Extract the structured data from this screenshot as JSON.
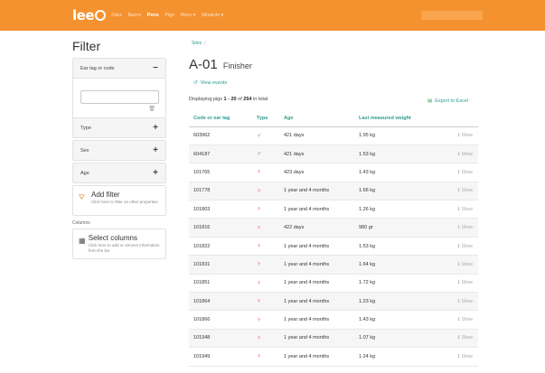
{
  "app": {
    "logo": "lee",
    "nav": [
      "Sites",
      "Barns",
      "Pens",
      "Pigs",
      "More ▾",
      "Wizards ▾"
    ],
    "nav_active_index": 2
  },
  "sidebar": {
    "title": "Filter",
    "ear_tag": {
      "label": "Ear tag or code",
      "value": "",
      "placeholder": ""
    },
    "filters": [
      {
        "label": "Type"
      },
      {
        "label": "Sex"
      },
      {
        "label": "Age"
      }
    ],
    "add_filter": {
      "title": "Add filter",
      "description": "Click here to filter on other properties"
    },
    "columns_label": "Columns",
    "select_columns": {
      "title": "Select columns",
      "description": "Click here to add or remove information from the list"
    }
  },
  "main": {
    "breadcrumb": "Sites",
    "title": "A-01",
    "subtitle": "Finisher",
    "view_events": "View events",
    "displaying": {
      "prefix": "Displaying pigs ",
      "range": "1 - 20",
      "mid": " of ",
      "total": "254",
      "suffix": " in total"
    },
    "export": "Export to Excel",
    "columns": [
      "Code or ear tag",
      "Type",
      "Age",
      "Last measured weight",
      ""
    ],
    "rows": [
      {
        "code": "603962",
        "sex": "♂",
        "sex_kind": "m",
        "age": "421 days",
        "weight": "1.95 kg",
        "action": "Show"
      },
      {
        "code": "604187",
        "sex": "♂",
        "sex_kind": "m",
        "age": "421 days",
        "weight": "1.53 kg",
        "action": "Show"
      },
      {
        "code": "101765",
        "sex": "♀",
        "sex_kind": "f",
        "age": "423 days",
        "weight": "1.43 kg",
        "action": "Show"
      },
      {
        "code": "101778",
        "sex": "♀",
        "sex_kind": "f",
        "age": "1 year and 4 months",
        "weight": "1.66 kg",
        "action": "Show"
      },
      {
        "code": "101803",
        "sex": "♀",
        "sex_kind": "f",
        "age": "1 year and 4 months",
        "weight": "1.26 kg",
        "action": "Show"
      },
      {
        "code": "101816",
        "sex": "♀",
        "sex_kind": "f",
        "age": "422 days",
        "weight": "980 gr",
        "action": "Show"
      },
      {
        "code": "101822",
        "sex": "♀",
        "sex_kind": "f",
        "age": "1 year and 4 months",
        "weight": "1.53 kg",
        "action": "Show"
      },
      {
        "code": "101831",
        "sex": "♀",
        "sex_kind": "f",
        "age": "1 year and 4 months",
        "weight": "1.64 kg",
        "action": "Show"
      },
      {
        "code": "101851",
        "sex": "♀",
        "sex_kind": "f",
        "age": "1 year and 4 months",
        "weight": "1.72 kg",
        "action": "Show"
      },
      {
        "code": "101864",
        "sex": "♀",
        "sex_kind": "f",
        "age": "1 year and 4 months",
        "weight": "1.23 kg",
        "action": "Show"
      },
      {
        "code": "101866",
        "sex": "♀",
        "sex_kind": "f",
        "age": "1 year and 4 months",
        "weight": "1.43 kg",
        "action": "Show"
      },
      {
        "code": "101948",
        "sex": "♀",
        "sex_kind": "f",
        "age": "1 year and 4 months",
        "weight": "1.07 kg",
        "action": "Show"
      },
      {
        "code": "101949",
        "sex": "♀",
        "sex_kind": "f",
        "age": "1 year and 4 months",
        "weight": "1.24 kg",
        "action": "Show"
      }
    ]
  },
  "colors": {
    "brand": "#f4922f",
    "accent": "#2a9d8f",
    "male": "#3a8fd0",
    "female": "#e0487a"
  }
}
